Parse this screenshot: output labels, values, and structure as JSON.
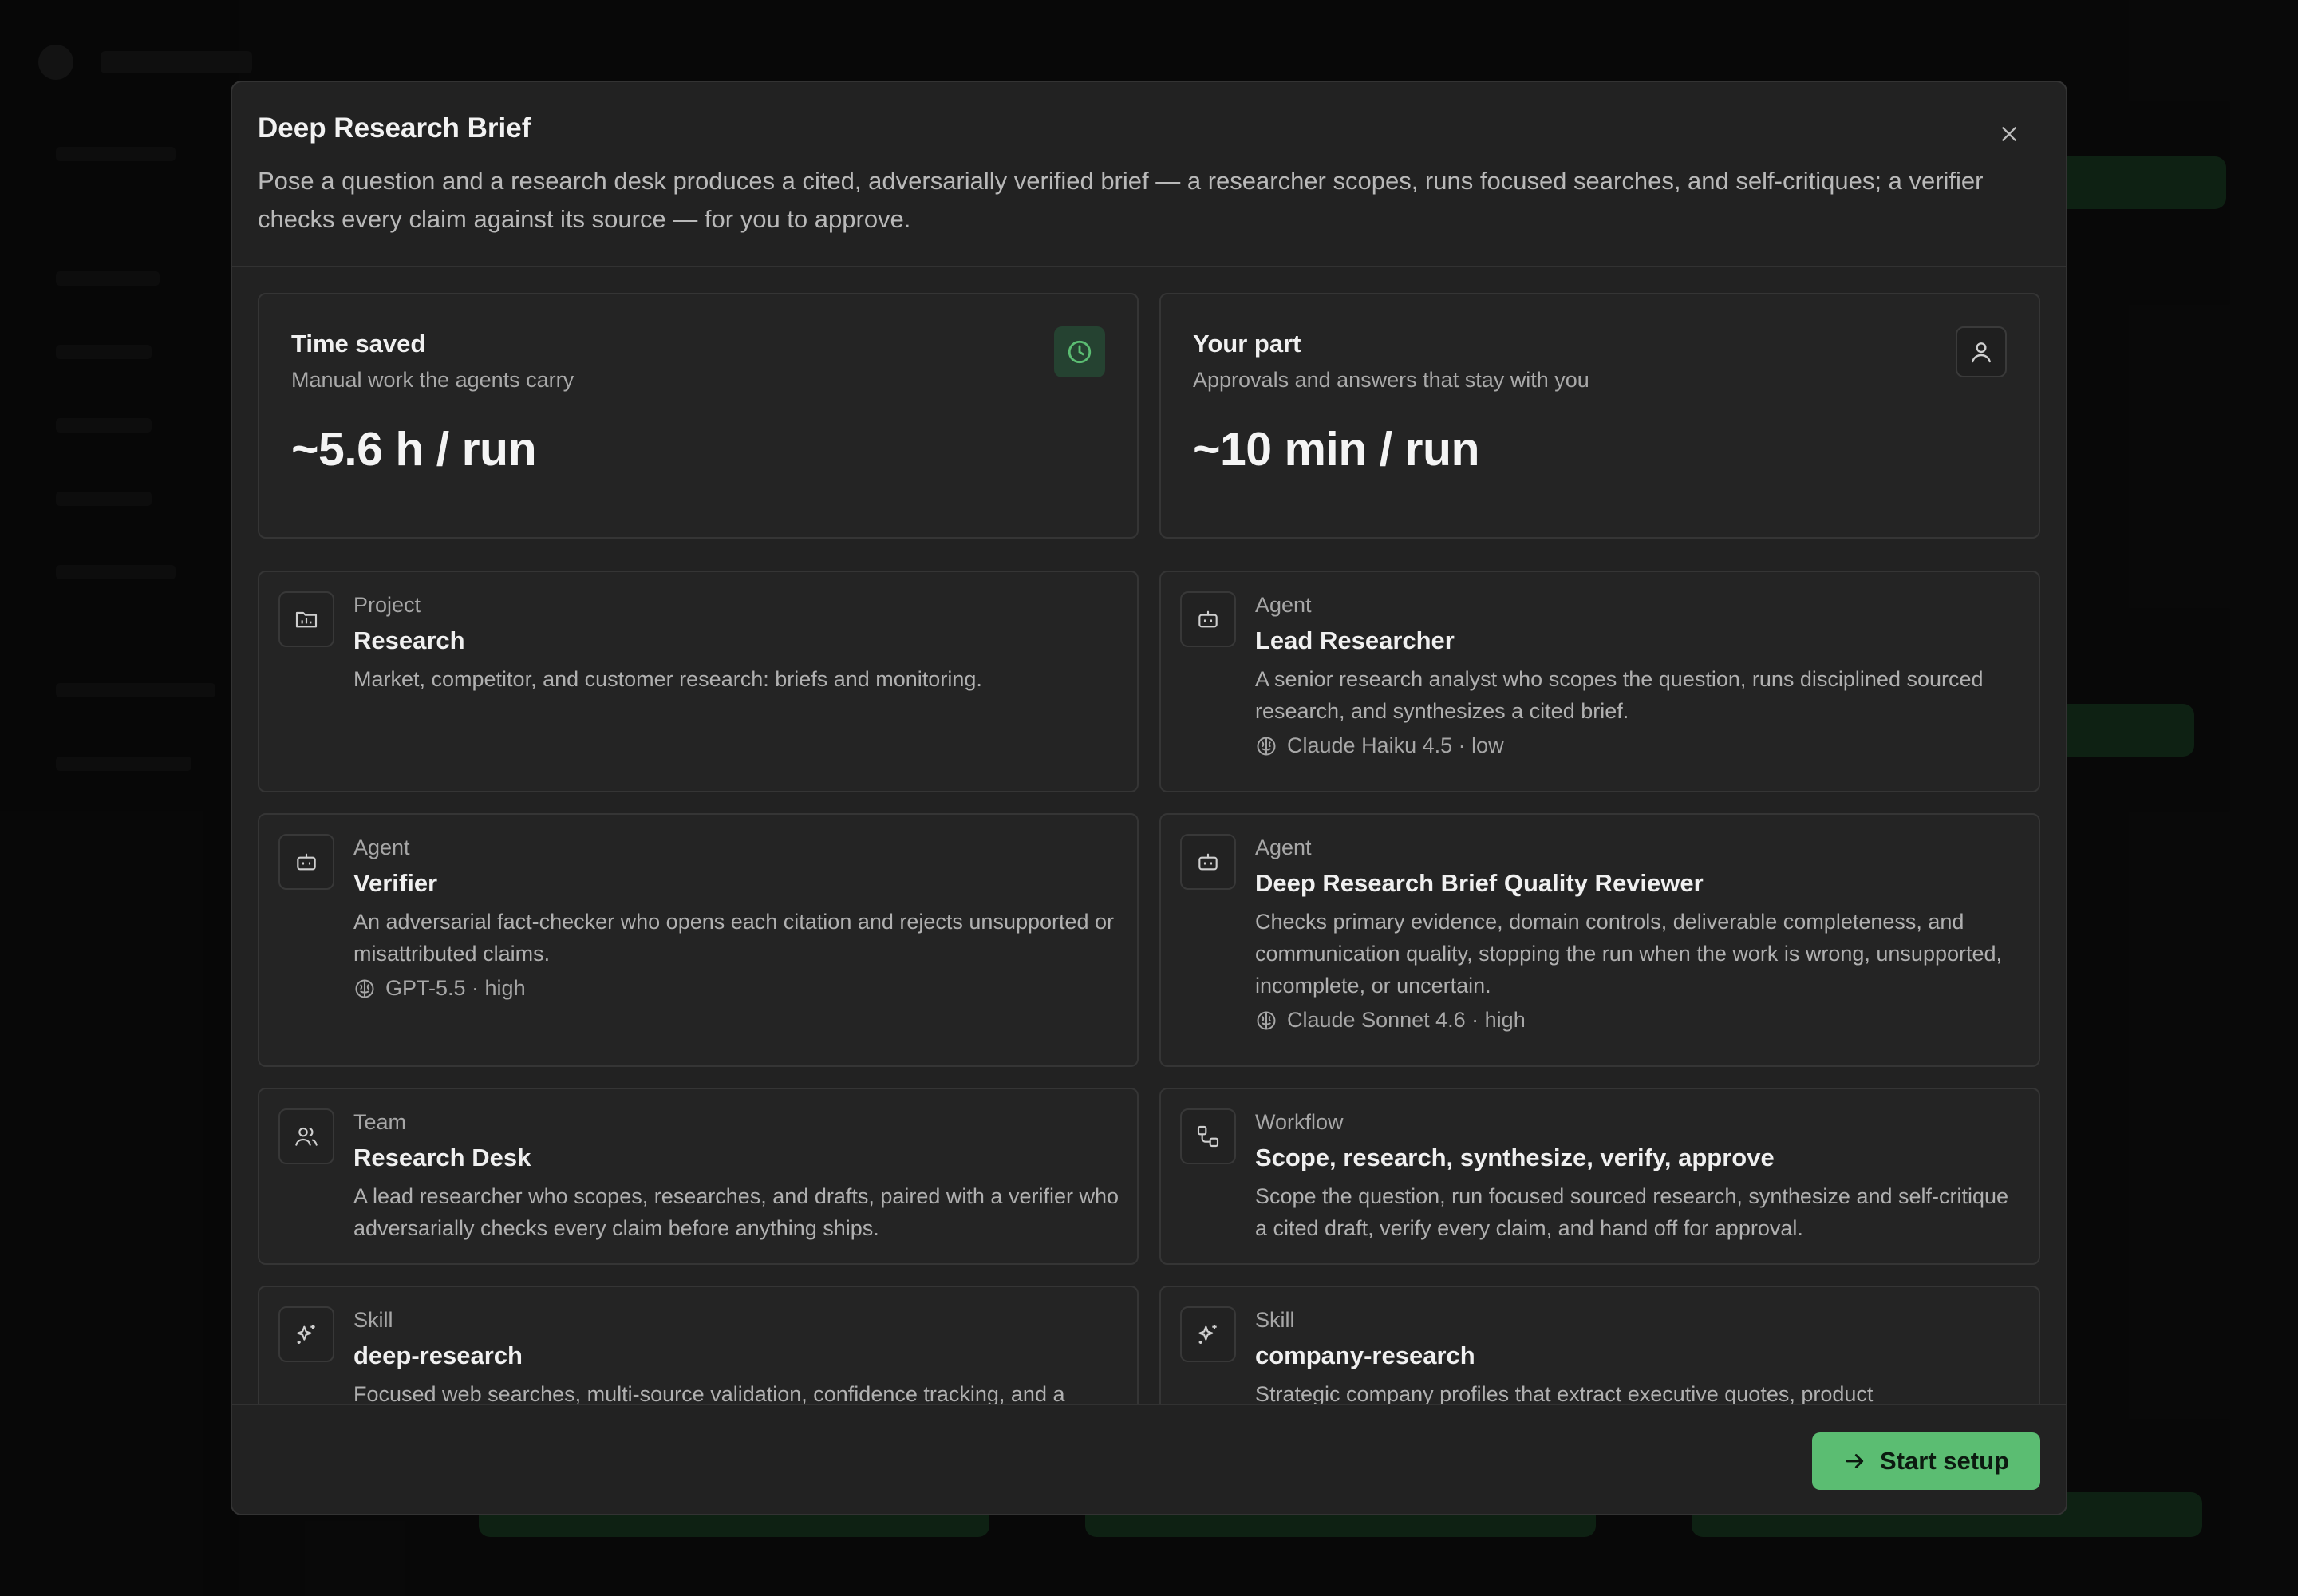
{
  "modal": {
    "title": "Deep Research Brief",
    "description": "Pose a question and a research desk produces a cited, adversarially verified brief — a researcher scopes, runs focused searches, and self-critiques; a verifier checks every claim against its source — for you to approve.",
    "close_icon": "close-icon",
    "stats": {
      "time_saved": {
        "title": "Time saved",
        "subtitle": "Manual work the agents carry",
        "value": "~5.6 h / run",
        "icon": "clock-icon"
      },
      "your_part": {
        "title": "Your part",
        "subtitle": "Approvals and answers that stay with you",
        "value": "~10 min / run",
        "icon": "user-icon"
      }
    },
    "items": [
      {
        "kind": "Project",
        "name": "Research",
        "description": "Market, competitor, and customer research: briefs and monitoring.",
        "icon": "folder-icon"
      },
      {
        "kind": "Agent",
        "name": "Lead Researcher",
        "description": "A senior research analyst who scopes the question, runs disciplined sourced research, and synthesizes a cited brief.",
        "model": "Claude Haiku 4.5 · low",
        "icon": "bot-icon"
      },
      {
        "kind": "Agent",
        "name": "Verifier",
        "description": "An adversarial fact-checker who opens each citation and rejects unsupported or misattributed claims.",
        "model": "GPT-5.5 · high",
        "icon": "bot-icon"
      },
      {
        "kind": "Agent",
        "name": "Deep Research Brief Quality Reviewer",
        "description": "Checks primary evidence, domain controls, deliverable completeness, and communication quality, stopping the run when the work is wrong, unsupported, incomplete, or uncertain.",
        "model": "Claude Sonnet 4.6 · high",
        "icon": "bot-icon"
      },
      {
        "kind": "Team",
        "name": "Research Desk",
        "description": "A lead researcher who scopes, researches, and drafts, paired with a verifier who adversarially checks every claim before anything ships.",
        "icon": "users-icon"
      },
      {
        "kind": "Workflow",
        "name": "Scope, research, synthesize, verify, approve",
        "description": "Scope the question, run focused sourced research, synthesize and self-critique a cited draft, verify every claim, and hand off for approval.",
        "icon": "workflow-icon"
      },
      {
        "kind": "Skill",
        "name": "deep-research",
        "description": "Focused web searches, multi-source validation, confidence tracking, and a",
        "icon": "sparkle-icon"
      },
      {
        "kind": "Skill",
        "name": "company-research",
        "description": "Strategic company profiles that extract executive quotes, product",
        "icon": "sparkle-icon"
      }
    ],
    "footer": {
      "start_label": "Start setup",
      "start_icon": "arrow-right-icon"
    }
  },
  "colors": {
    "accent": "#5bbd72",
    "modal_bg": "#222222",
    "card_bg": "#242424"
  }
}
